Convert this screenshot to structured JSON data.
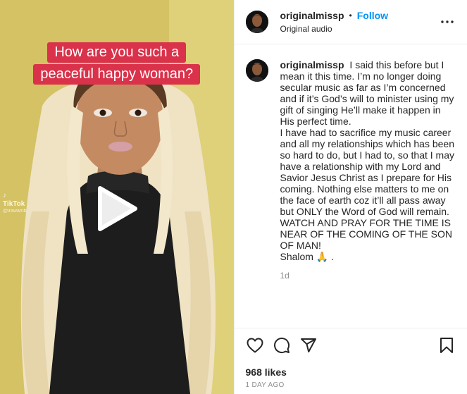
{
  "media": {
    "overlay_lines": [
      "How are you such a",
      "peaceful happy woman?"
    ],
    "watermark_brand": "TikTok",
    "watermark_handle": "@irawamb",
    "play_icon": "play-icon"
  },
  "header": {
    "username": "originalmissp",
    "separator": "•",
    "follow_label": "Follow",
    "audio_label": "Original audio",
    "more_icon": "more-horizontal-icon"
  },
  "caption": {
    "username": "originalmissp",
    "paragraphs": [
      "I said this before but I mean it this time. I’m no longer doing secular music as far as I’m concerned and if it’s God’s will to minister using my gift of singing He’ll make it happen in His perfect time.",
      "I have had to sacrifice my music career and all my relationships which has been so hard to do, but I had to, so that I may have a relationship with my Lord and Savior Jesus Christ as I prepare for His coming. Nothing else matters to me on the face of earth coz it’ll all pass away but ONLY the Word of God will remain.",
      "WATCH AND PRAY FOR THE TIME IS NEAR OF THE COMING OF THE SON OF MAN!",
      "Shalom 🙏 ."
    ],
    "time_ago": "1d"
  },
  "actions": {
    "like_icon": "heart-icon",
    "comment_icon": "comment-icon",
    "share_icon": "share-icon",
    "save_icon": "bookmark-icon"
  },
  "stats": {
    "likes": "968 likes",
    "posted": "1 DAY AGO"
  },
  "colors": {
    "follow": "#0095f6",
    "overlay_caption": "#d9324a",
    "muted": "#8e8e8e"
  }
}
